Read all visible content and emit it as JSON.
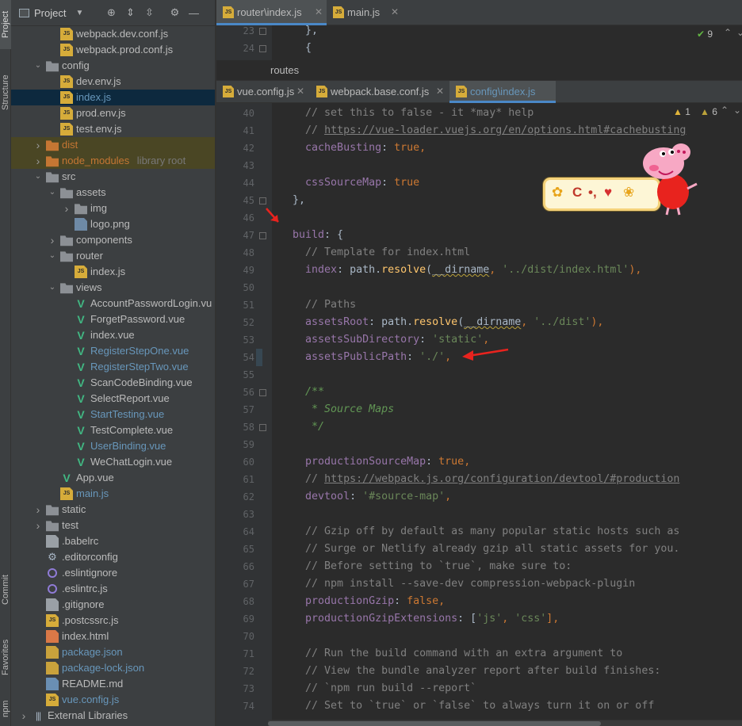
{
  "toolstrip": {
    "project": "Project",
    "structure": "Structure",
    "commit": "Commit",
    "favorites": "Favorites",
    "npm": "npm"
  },
  "project_panel": {
    "title": "Project",
    "tree": [
      {
        "label": "webpack.dev.conf.js",
        "icon": "js-file-icon",
        "depth": 3,
        "arrow": ""
      },
      {
        "label": "webpack.prod.conf.js",
        "icon": "js-file-icon",
        "depth": 3,
        "arrow": ""
      },
      {
        "label": "config",
        "icon": "folder-icon",
        "depth": 2,
        "arrow": "open"
      },
      {
        "label": "dev.env.js",
        "icon": "js-file-icon",
        "depth": 3,
        "arrow": ""
      },
      {
        "label": "index.js",
        "icon": "js-file-icon",
        "depth": 3,
        "arrow": "",
        "selected": true,
        "color": "modified"
      },
      {
        "label": "prod.env.js",
        "icon": "js-file-icon",
        "depth": 3,
        "arrow": ""
      },
      {
        "label": "test.env.js",
        "icon": "js-file-icon",
        "depth": 3,
        "arrow": ""
      },
      {
        "label": "dist",
        "icon": "folder-icon",
        "depth": 2,
        "arrow": "closed",
        "excluded": true,
        "color": "orange"
      },
      {
        "label": "node_modules",
        "icon": "folder-icon",
        "depth": 2,
        "arrow": "closed",
        "excluded": true,
        "color": "orange",
        "suffix": "library root"
      },
      {
        "label": "src",
        "icon": "folder-icon",
        "depth": 2,
        "arrow": "open"
      },
      {
        "label": "assets",
        "icon": "folder-icon",
        "depth": 3,
        "arrow": "open"
      },
      {
        "label": "img",
        "icon": "folder-icon",
        "depth": 4,
        "arrow": "closed"
      },
      {
        "label": "logo.png",
        "icon": "image-file-icon",
        "depth": 4,
        "arrow": ""
      },
      {
        "label": "components",
        "icon": "folder-icon",
        "depth": 3,
        "arrow": "closed"
      },
      {
        "label": "router",
        "icon": "folder-icon",
        "depth": 3,
        "arrow": "open"
      },
      {
        "label": "index.js",
        "icon": "js-file-icon",
        "depth": 4,
        "arrow": ""
      },
      {
        "label": "views",
        "icon": "folder-icon",
        "depth": 3,
        "arrow": "open"
      },
      {
        "label": "AccountPasswordLogin.vu",
        "icon": "vue-file-icon",
        "depth": 4,
        "arrow": ""
      },
      {
        "label": "ForgetPassword.vue",
        "icon": "vue-file-icon",
        "depth": 4,
        "arrow": ""
      },
      {
        "label": "index.vue",
        "icon": "vue-file-icon",
        "depth": 4,
        "arrow": ""
      },
      {
        "label": "RegisterStepOne.vue",
        "icon": "vue-file-icon",
        "depth": 4,
        "arrow": "",
        "color": "modified"
      },
      {
        "label": "RegisterStepTwo.vue",
        "icon": "vue-file-icon",
        "depth": 4,
        "arrow": "",
        "color": "modified"
      },
      {
        "label": "ScanCodeBinding.vue",
        "icon": "vue-file-icon",
        "depth": 4,
        "arrow": ""
      },
      {
        "label": "SelectReport.vue",
        "icon": "vue-file-icon",
        "depth": 4,
        "arrow": ""
      },
      {
        "label": "StartTesting.vue",
        "icon": "vue-file-icon",
        "depth": 4,
        "arrow": "",
        "color": "modified"
      },
      {
        "label": "TestComplete.vue",
        "icon": "vue-file-icon",
        "depth": 4,
        "arrow": ""
      },
      {
        "label": "UserBinding.vue",
        "icon": "vue-file-icon",
        "depth": 4,
        "arrow": "",
        "color": "modified"
      },
      {
        "label": "WeChatLogin.vue",
        "icon": "vue-file-icon",
        "depth": 4,
        "arrow": ""
      },
      {
        "label": "App.vue",
        "icon": "vue-file-icon",
        "depth": 3,
        "arrow": ""
      },
      {
        "label": "main.js",
        "icon": "js-file-icon",
        "depth": 3,
        "arrow": "",
        "color": "modified"
      },
      {
        "label": "static",
        "icon": "folder-icon",
        "depth": 2,
        "arrow": "closed"
      },
      {
        "label": "test",
        "icon": "folder-icon",
        "depth": 2,
        "arrow": "closed"
      },
      {
        "label": ".babelrc",
        "icon": "generic-file-icon",
        "depth": 2,
        "arrow": ""
      },
      {
        "label": ".editorconfig",
        "icon": "gear-file-icon",
        "depth": 2,
        "arrow": ""
      },
      {
        "label": ".eslintignore",
        "icon": "eslint-file-icon",
        "depth": 2,
        "arrow": ""
      },
      {
        "label": ".eslintrc.js",
        "icon": "eslint-file-icon",
        "depth": 2,
        "arrow": ""
      },
      {
        "label": ".gitignore",
        "icon": "generic-file-icon",
        "depth": 2,
        "arrow": ""
      },
      {
        "label": ".postcssrc.js",
        "icon": "js-file-icon",
        "depth": 2,
        "arrow": ""
      },
      {
        "label": "index.html",
        "icon": "html-file-icon",
        "depth": 2,
        "arrow": ""
      },
      {
        "label": "package.json",
        "icon": "json-file-icon",
        "depth": 2,
        "arrow": "",
        "color": "modified"
      },
      {
        "label": "package-lock.json",
        "icon": "json-file-icon",
        "depth": 2,
        "arrow": "",
        "color": "modified"
      },
      {
        "label": "README.md",
        "icon": "md-file-icon",
        "depth": 2,
        "arrow": ""
      },
      {
        "label": "vue.config.js",
        "icon": "js-file-icon",
        "depth": 2,
        "arrow": "",
        "color": "modified"
      },
      {
        "label": "External Libraries",
        "icon": "library-icon",
        "depth": 1,
        "arrow": "closed"
      }
    ]
  },
  "top_tabs": [
    {
      "label": "router\\index.js",
      "active": true
    },
    {
      "label": "main.js",
      "active": false
    }
  ],
  "bottom_tabs": [
    {
      "label": "vue.config.js",
      "active": false
    },
    {
      "label": "webpack.base.conf.js",
      "active": false
    },
    {
      "label": "config\\index.js",
      "active": true
    }
  ],
  "top_editor": {
    "check_count": "9",
    "lines": [
      {
        "n": "23",
        "html": "    },"
      },
      {
        "n": "24",
        "html": "    {"
      }
    ]
  },
  "breadcrumb": "routes",
  "bottom_editor": {
    "warnings": "1",
    "weak_warnings": "6",
    "lines": [
      {
        "n": "40",
        "tokens": [
          [
            "    ",
            "p"
          ],
          [
            "// set this to false - it *may* help",
            "c"
          ]
        ]
      },
      {
        "n": "41",
        "tokens": [
          [
            "    ",
            "p"
          ],
          [
            "// ",
            "c"
          ],
          [
            "https://vue-loader.vuejs.org/en/options.html#cachebusting",
            "l"
          ]
        ]
      },
      {
        "n": "42",
        "tokens": [
          [
            "    ",
            "p"
          ],
          [
            "cacheBusting",
            "k"
          ],
          [
            ": ",
            "p"
          ],
          [
            "true",
            "w"
          ],
          [
            ",",
            "w"
          ]
        ]
      },
      {
        "n": "43",
        "tokens": []
      },
      {
        "n": "44",
        "tokens": [
          [
            "    ",
            "p"
          ],
          [
            "cssSourceMap",
            "k"
          ],
          [
            ": ",
            "p"
          ],
          [
            "true",
            "w"
          ]
        ]
      },
      {
        "n": "45",
        "tokens": [
          [
            "  },",
            "p"
          ]
        ]
      },
      {
        "n": "46",
        "tokens": []
      },
      {
        "n": "47",
        "tokens": [
          [
            "  ",
            "p"
          ],
          [
            "build",
            "k"
          ],
          [
            ": {",
            "p"
          ]
        ]
      },
      {
        "n": "48",
        "tokens": [
          [
            "    ",
            "p"
          ],
          [
            "// Template for index.html",
            "c"
          ]
        ]
      },
      {
        "n": "49",
        "tokens": [
          [
            "    ",
            "p"
          ],
          [
            "index",
            "k"
          ],
          [
            ": path.",
            "p"
          ],
          [
            "resolve",
            "f"
          ],
          [
            "(",
            "p"
          ],
          [
            "__dirname",
            "u"
          ],
          [
            ", ",
            "w"
          ],
          [
            "'../dist/index.html'",
            "s"
          ],
          [
            "),",
            "w"
          ]
        ]
      },
      {
        "n": "50",
        "tokens": []
      },
      {
        "n": "51",
        "tokens": [
          [
            "    ",
            "p"
          ],
          [
            "// Paths",
            "c"
          ]
        ]
      },
      {
        "n": "52",
        "tokens": [
          [
            "    ",
            "p"
          ],
          [
            "assetsRoot",
            "k"
          ],
          [
            ": path.",
            "p"
          ],
          [
            "resolve",
            "f"
          ],
          [
            "(",
            "p"
          ],
          [
            "__dirname",
            "u"
          ],
          [
            ", ",
            "w"
          ],
          [
            "'../dist'",
            "s"
          ],
          [
            "),",
            "w"
          ]
        ]
      },
      {
        "n": "53",
        "tokens": [
          [
            "    ",
            "p"
          ],
          [
            "assetsSubDirectory",
            "k"
          ],
          [
            ": ",
            "p"
          ],
          [
            "'static'",
            "s"
          ],
          [
            ",",
            "w"
          ]
        ]
      },
      {
        "n": "54",
        "tokens": [
          [
            "    ",
            "p"
          ],
          [
            "assetsPublicPath",
            "k"
          ],
          [
            ": ",
            "p"
          ],
          [
            "'./'",
            "s"
          ],
          [
            ",",
            "w"
          ]
        ]
      },
      {
        "n": "55",
        "tokens": []
      },
      {
        "n": "56",
        "tokens": [
          [
            "    ",
            "p"
          ],
          [
            "/**",
            "d"
          ]
        ]
      },
      {
        "n": "57",
        "tokens": [
          [
            "     ",
            "p"
          ],
          [
            "* Source Maps",
            "d"
          ]
        ]
      },
      {
        "n": "58",
        "tokens": [
          [
            "     ",
            "p"
          ],
          [
            "*/",
            "d"
          ]
        ]
      },
      {
        "n": "59",
        "tokens": []
      },
      {
        "n": "60",
        "tokens": [
          [
            "    ",
            "p"
          ],
          [
            "productionSourceMap",
            "k"
          ],
          [
            ": ",
            "p"
          ],
          [
            "true",
            "w"
          ],
          [
            ",",
            "w"
          ]
        ]
      },
      {
        "n": "61",
        "tokens": [
          [
            "    ",
            "p"
          ],
          [
            "// ",
            "c"
          ],
          [
            "https://webpack.js.org/configuration/devtool/#production",
            "l"
          ]
        ]
      },
      {
        "n": "62",
        "tokens": [
          [
            "    ",
            "p"
          ],
          [
            "devtool",
            "k"
          ],
          [
            ": ",
            "p"
          ],
          [
            "'#source-map'",
            "s"
          ],
          [
            ",",
            "w"
          ]
        ]
      },
      {
        "n": "63",
        "tokens": []
      },
      {
        "n": "64",
        "tokens": [
          [
            "    ",
            "p"
          ],
          [
            "// Gzip off by default as many popular static hosts such as",
            "c"
          ]
        ]
      },
      {
        "n": "65",
        "tokens": [
          [
            "    ",
            "p"
          ],
          [
            "// Surge or Netlify already gzip all static assets for you.",
            "c"
          ]
        ]
      },
      {
        "n": "66",
        "tokens": [
          [
            "    ",
            "p"
          ],
          [
            "// Before setting to `true`, make sure to:",
            "c"
          ]
        ]
      },
      {
        "n": "67",
        "tokens": [
          [
            "    ",
            "p"
          ],
          [
            "// npm install --save-dev compression-webpack-plugin",
            "c"
          ]
        ]
      },
      {
        "n": "68",
        "tokens": [
          [
            "    ",
            "p"
          ],
          [
            "productionGzip",
            "k"
          ],
          [
            ": ",
            "p"
          ],
          [
            "false",
            "w"
          ],
          [
            ",",
            "w"
          ]
        ]
      },
      {
        "n": "69",
        "tokens": [
          [
            "    ",
            "p"
          ],
          [
            "productionGzipExtensions",
            "k"
          ],
          [
            ": [",
            "p"
          ],
          [
            "'js'",
            "s"
          ],
          [
            ", ",
            "w"
          ],
          [
            "'css'",
            "s"
          ],
          [
            "],",
            "w"
          ]
        ]
      },
      {
        "n": "70",
        "tokens": []
      },
      {
        "n": "71",
        "tokens": [
          [
            "    ",
            "p"
          ],
          [
            "// Run the build command with an extra argument to",
            "c"
          ]
        ]
      },
      {
        "n": "72",
        "tokens": [
          [
            "    ",
            "p"
          ],
          [
            "// View the bundle analyzer report after build finishes:",
            "c"
          ]
        ]
      },
      {
        "n": "73",
        "tokens": [
          [
            "    ",
            "p"
          ],
          [
            "// `npm run build --report`",
            "c"
          ]
        ]
      },
      {
        "n": "74",
        "tokens": [
          [
            "    ",
            "p"
          ],
          [
            "// Set to `true` or `false` to always turn it on or off",
            "c"
          ]
        ]
      }
    ]
  },
  "colors": {
    "accent": "#4a88c7",
    "selection": "#0d293e",
    "excluded": "#4a4624",
    "annotation_arrow": "#e8231e"
  }
}
